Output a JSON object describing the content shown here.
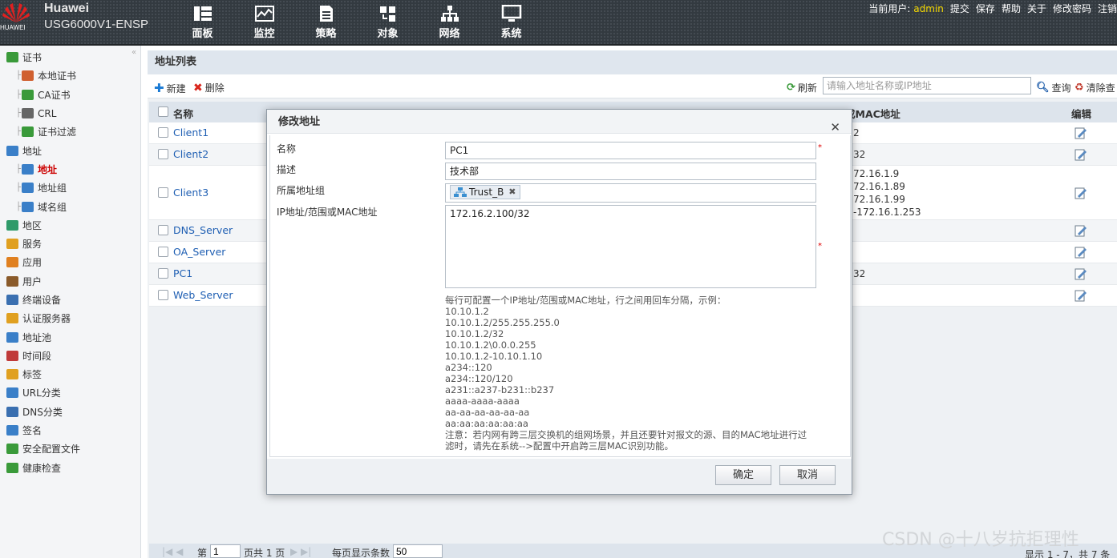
{
  "brand": {
    "company": "Huawei",
    "model": "USG6000V1-ENSP",
    "logo_word": "HUAWEI"
  },
  "nav": [
    "面板",
    "监控",
    "策略",
    "对象",
    "网络",
    "系统"
  ],
  "top_links": {
    "current_user_label": "当前用户:",
    "user": "admin",
    "submit": "提交",
    "save": "保存",
    "help": "帮助",
    "about": "关于",
    "change_password": "修改密码",
    "logout": "注销"
  },
  "sidebar": [
    {
      "label": "证书",
      "level": 1,
      "icon": "certificate-icon"
    },
    {
      "label": "本地证书",
      "level": 2,
      "icon": "local-cert-icon"
    },
    {
      "label": "CA证书",
      "level": 2,
      "icon": "ca-cert-icon"
    },
    {
      "label": "CRL",
      "level": 2,
      "icon": "crl-icon"
    },
    {
      "label": "证书过滤",
      "level": 2,
      "icon": "cert-filter-icon"
    },
    {
      "label": "地址",
      "level": 1,
      "icon": "address-icon"
    },
    {
      "label": "地址",
      "level": 2,
      "icon": "address-item-icon",
      "active": true
    },
    {
      "label": "地址组",
      "level": 2,
      "icon": "address-group-icon"
    },
    {
      "label": "域名组",
      "level": 2,
      "icon": "domain-group-icon"
    },
    {
      "label": "地区",
      "level": 1,
      "icon": "region-icon"
    },
    {
      "label": "服务",
      "level": 1,
      "icon": "service-icon"
    },
    {
      "label": "应用",
      "level": 1,
      "icon": "application-icon"
    },
    {
      "label": "用户",
      "level": 1,
      "icon": "user-icon"
    },
    {
      "label": "终端设备",
      "level": 1,
      "icon": "terminal-device-icon"
    },
    {
      "label": "认证服务器",
      "level": 1,
      "icon": "auth-server-icon"
    },
    {
      "label": "地址池",
      "level": 1,
      "icon": "address-pool-icon"
    },
    {
      "label": "时间段",
      "level": 1,
      "icon": "time-range-icon"
    },
    {
      "label": "标签",
      "level": 1,
      "icon": "tag-icon"
    },
    {
      "label": "URL分类",
      "level": 1,
      "icon": "url-category-icon"
    },
    {
      "label": "DNS分类",
      "level": 1,
      "icon": "dns-category-icon"
    },
    {
      "label": "签名",
      "level": 1,
      "icon": "signature-icon"
    },
    {
      "label": "安全配置文件",
      "level": 1,
      "icon": "security-profile-icon"
    },
    {
      "label": "健康检查",
      "level": 1,
      "icon": "health-check-icon"
    }
  ],
  "panel": {
    "title": "地址列表",
    "toolbar": {
      "new": "新建",
      "delete": "删除",
      "refresh": "刷新",
      "search_placeholder": "请输入地址名称或IP地址",
      "query": "查询",
      "clear": "清除查"
    },
    "columns": {
      "name": "名称",
      "address": "或MAC地址",
      "edit": "编辑"
    },
    "rows": [
      {
        "name": "Client1",
        "addr": [
          "2"
        ]
      },
      {
        "name": "Client2",
        "addr": [
          "32"
        ]
      },
      {
        "name": "Client3",
        "addr": [
          "72.16.1.9",
          "72.16.1.89",
          "72.16.1.99",
          "-172.16.1.253"
        ]
      },
      {
        "name": "DNS_Server",
        "addr": []
      },
      {
        "name": "OA_Server",
        "addr": []
      },
      {
        "name": "PC1",
        "addr": [
          "32"
        ]
      },
      {
        "name": "Web_Server",
        "addr": []
      }
    ],
    "pager": {
      "page_prefix": "第",
      "page": "1",
      "page_suffix": "页共 1 页",
      "per_page_label": "每页显示条数",
      "per_page": "50",
      "summary": "显示 1 - 7，共 7 条"
    }
  },
  "dialog": {
    "title": "修改地址",
    "name_label": "名称",
    "name_value": "PC1",
    "desc_label": "描述",
    "desc_value": "技术部",
    "group_label": "所属地址组",
    "group_chip": "Trust_B",
    "ip_label": "IP地址/范围或MAC地址",
    "ip_value": "172.16.2.100/32",
    "hint_lines": [
      "每行可配置一个IP地址/范围或MAC地址，行之间用回车分隔，示例：",
      "10.10.1.2",
      "10.10.1.2/255.255.255.0",
      "10.10.1.2/32",
      "10.10.1.2\\0.0.0.255",
      "10.10.1.2-10.10.1.10",
      "a234::120",
      "a234::120/120",
      "a231::a237-b231::b237",
      "aaaa-aaaa-aaaa",
      "aa-aa-aa-aa-aa-aa",
      "aa:aa:aa:aa:aa:aa",
      "注意：若内网有跨三层交换机的组网场景，并且还要针对报文的源、目的MAC地址进行过",
      "滤时，请先在系统-->配置中开启跨三层MAC识别功能。"
    ],
    "ok": "确定",
    "cancel": "取消"
  },
  "watermark": "CSDN @十八岁抗拒理性"
}
